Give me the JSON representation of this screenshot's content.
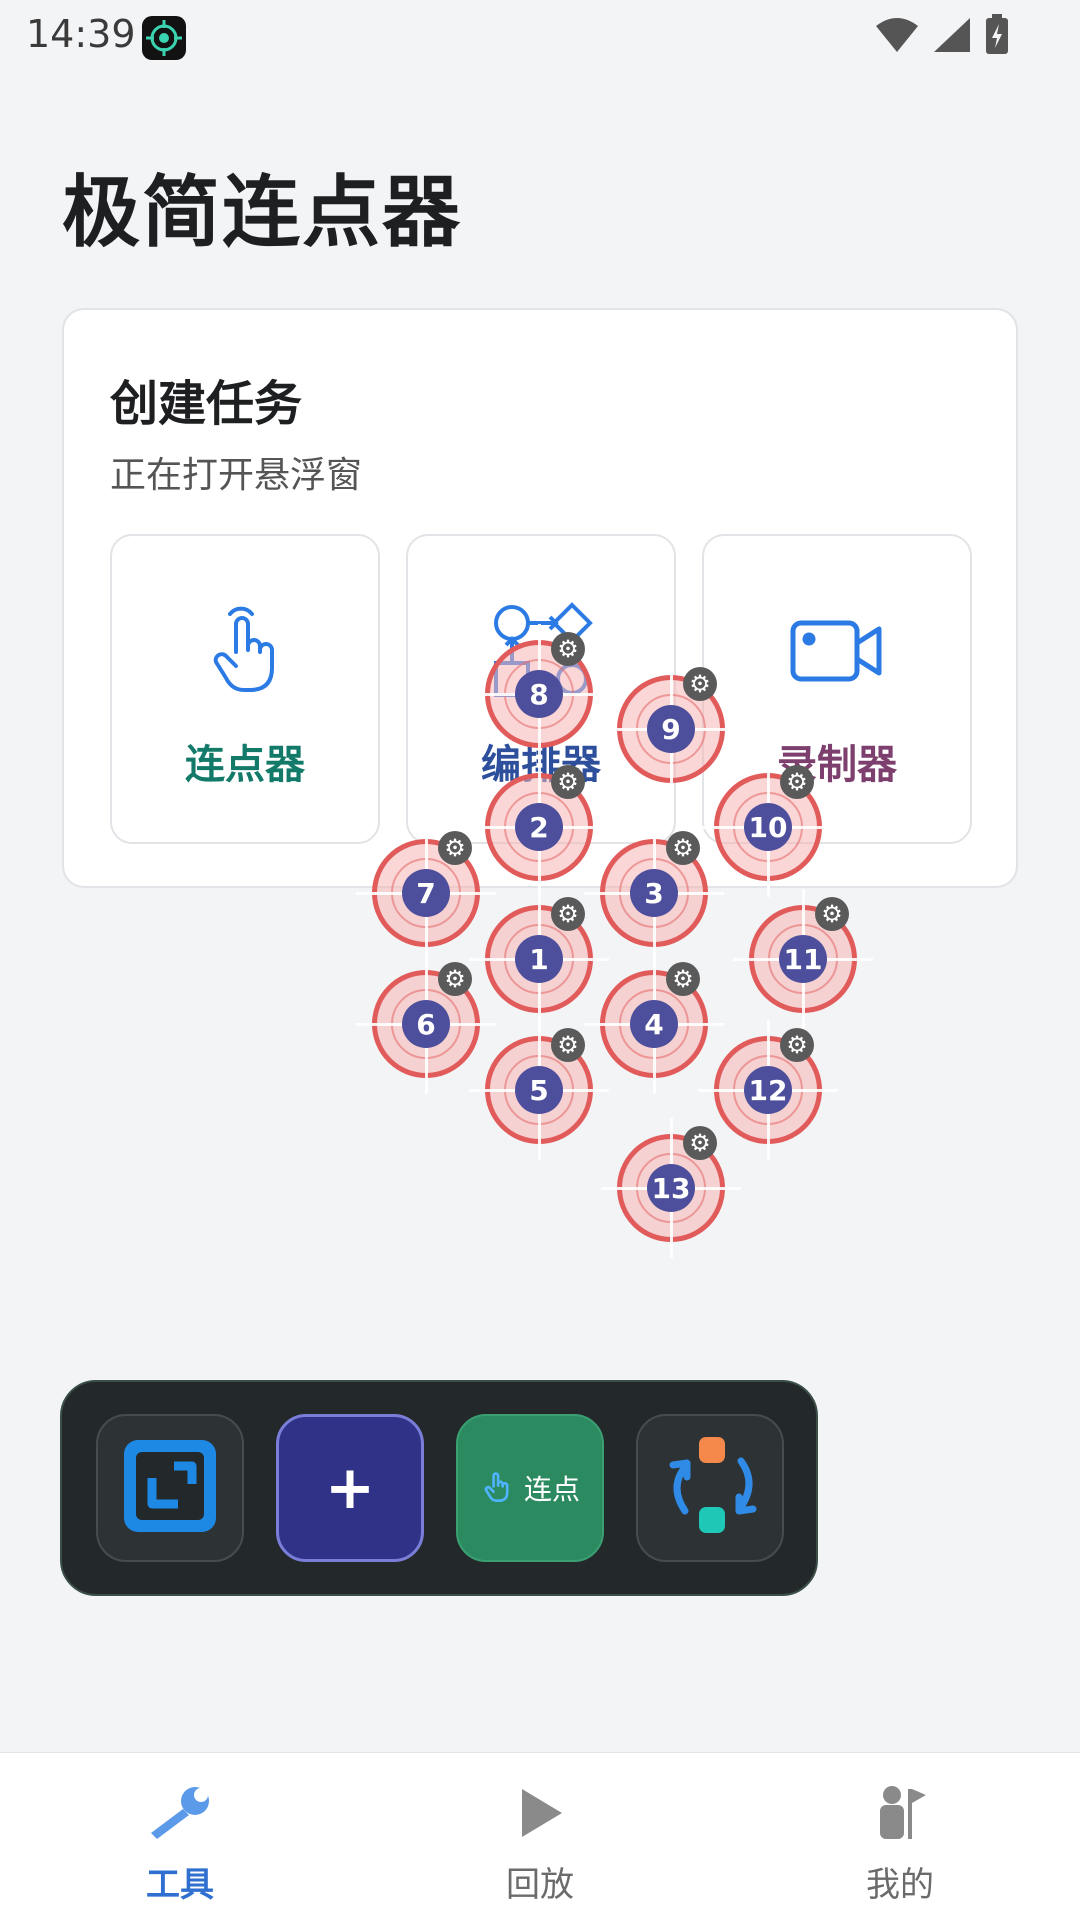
{
  "status": {
    "time": "14:39"
  },
  "title": "极简连点器",
  "card": {
    "title": "创建任务",
    "subtitle": "正在打开悬浮窗",
    "tiles": [
      {
        "label": "连点器",
        "color": "#137a6a",
        "icon": "tap-hand-icon"
      },
      {
        "label": "编排器",
        "color": "#2d4f9c",
        "icon": "flowchart-icon"
      },
      {
        "label": "录制器",
        "color": "#7d3f6d",
        "icon": "video-camera-icon"
      }
    ]
  },
  "markers": [
    {
      "n": "1"
    },
    {
      "n": "2"
    },
    {
      "n": "3"
    },
    {
      "n": "4"
    },
    {
      "n": "5"
    },
    {
      "n": "6"
    },
    {
      "n": "7"
    },
    {
      "n": "8"
    },
    {
      "n": "9"
    },
    {
      "n": "10"
    },
    {
      "n": "11"
    },
    {
      "n": "12"
    },
    {
      "n": "13"
    }
  ],
  "toolbar": {
    "plus_label": "+",
    "click_label": "连点"
  },
  "nav": {
    "items": [
      {
        "label": "工具",
        "active": true
      },
      {
        "label": "回放",
        "active": false
      },
      {
        "label": "我的",
        "active": false
      }
    ],
    "active_color": "#2f6fcf",
    "inactive_color": "#6b6b6b"
  }
}
